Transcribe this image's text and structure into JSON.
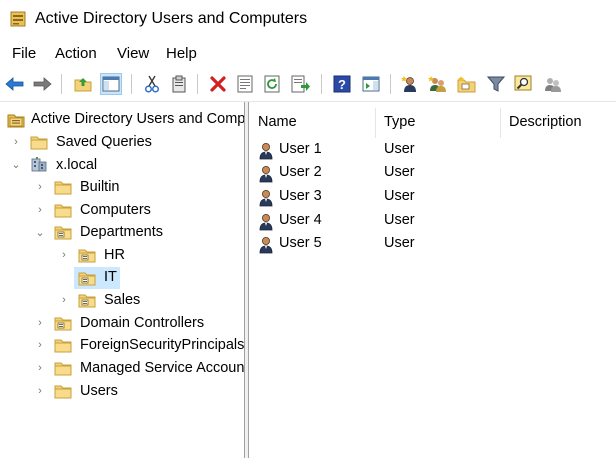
{
  "window": {
    "title": "Active Directory Users and Computers"
  },
  "menu": {
    "items": [
      "File",
      "Action",
      "View",
      "Help"
    ]
  },
  "toolbar": {
    "buttons": [
      "back-arrow-icon",
      "forward-arrow-icon",
      "up-folder-icon",
      "show-hide-console-tree-icon",
      "cut-icon",
      "copy-icon",
      "delete-icon",
      "properties-icon",
      "refresh-icon",
      "export-list-icon",
      "help-icon",
      "show-action-pane-icon",
      "new-user-icon",
      "new-group-icon",
      "new-ou-icon",
      "filter-icon",
      "find-icon",
      "add-to-group-icon"
    ]
  },
  "tree": {
    "root": "Active Directory Users and Comp",
    "items": [
      {
        "label": "Saved Queries"
      },
      {
        "label": "x.local"
      },
      {
        "label": "Builtin"
      },
      {
        "label": "Computers"
      },
      {
        "label": "Departments"
      },
      {
        "label": "HR"
      },
      {
        "label": "IT"
      },
      {
        "label": "Sales"
      },
      {
        "label": "Domain Controllers"
      },
      {
        "label": "ForeignSecurityPrincipals"
      },
      {
        "label": "Managed Service Accoun"
      },
      {
        "label": "Users"
      }
    ],
    "selected": "IT"
  },
  "list": {
    "columns": [
      "Name",
      "Type",
      "Description"
    ],
    "rows": [
      {
        "name": "User 1",
        "type": "User",
        "description": ""
      },
      {
        "name": "User 2",
        "type": "User",
        "description": ""
      },
      {
        "name": "User 3",
        "type": "User",
        "description": ""
      },
      {
        "name": "User 4",
        "type": "User",
        "description": ""
      },
      {
        "name": "User 5",
        "type": "User",
        "description": ""
      }
    ]
  },
  "colors": {
    "selection": "#cce8ff",
    "folder": "#e8c45c",
    "accent": "#0078d7"
  }
}
